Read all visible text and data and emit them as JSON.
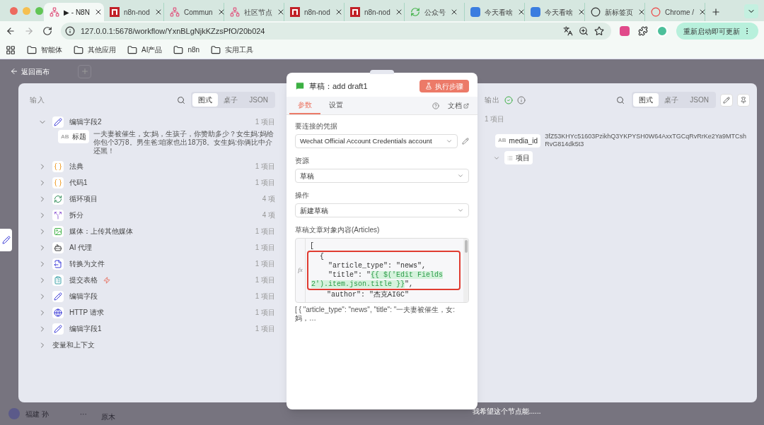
{
  "browser": {
    "tabs": [
      {
        "label": "▶ - N8N",
        "kind": "graph",
        "selected": true
      },
      {
        "label": "n8n-nod",
        "kind": "package",
        "selected": false
      },
      {
        "label": "Commun",
        "kind": "graph",
        "selected": false
      },
      {
        "label": "社区节点",
        "kind": "graph",
        "selected": false
      },
      {
        "label": "n8n-nod",
        "kind": "package",
        "selected": false
      },
      {
        "label": "n8n-nod",
        "kind": "package",
        "selected": false
      },
      {
        "label": "公众号",
        "kind": "recycle",
        "selected": false
      },
      {
        "label": "今天看啥",
        "kind": "square",
        "selected": false
      },
      {
        "label": "今天看啥",
        "kind": "square",
        "selected": false
      },
      {
        "label": "新标签页",
        "kind": "ring",
        "selected": false
      },
      {
        "label": "Chrome /",
        "kind": "redring",
        "selected": false
      }
    ],
    "url": "127.0.0.1:5678/workflow/YxnBLgNjkKZzsPfO/20b024",
    "update_button": "重新启动即可更新",
    "bookmarks": [
      "智能体",
      "其他应用",
      "AI产品",
      "n8n",
      "实用工具"
    ]
  },
  "back_link": "返回画布",
  "input_panel": {
    "title": "输入",
    "view_tabs": [
      {
        "label": "图式",
        "selected": true
      },
      {
        "label": "桌子",
        "selected": false
      },
      {
        "label": "JSON",
        "selected": false
      }
    ],
    "nodes": [
      {
        "kind": "edit",
        "name": "编辑字段2",
        "count": "1 项目",
        "expanded": true,
        "trigger": false,
        "fields": [
          {
            "type_badge": "AB",
            "key": "标题",
            "value": "一夫妻被催生，女:妈，生孩子，你赞助多少？女生妈:妈给你包个3万8。男生爸:咱家也出18万8。女生妈:你俩比中介还黑！"
          }
        ]
      },
      {
        "kind": "code",
        "name": "法典",
        "count": "1 项目",
        "expanded": false,
        "trigger": false
      },
      {
        "kind": "code",
        "name": "代码1",
        "count": "1 项目",
        "expanded": false,
        "trigger": false
      },
      {
        "kind": "loop",
        "name": "循环项目",
        "count": "4 项",
        "expanded": false,
        "trigger": false
      },
      {
        "kind": "split",
        "name": "拆分",
        "count": "4 项",
        "expanded": false,
        "trigger": false
      },
      {
        "kind": "media",
        "name": "媒体：上传其他媒体",
        "count": "1 项目",
        "expanded": false,
        "trigger": false
      },
      {
        "kind": "ai",
        "name": "AI 代理",
        "count": "1 项目",
        "expanded": false,
        "trigger": false
      },
      {
        "kind": "file",
        "name": "转换为文件",
        "count": "1 项目",
        "expanded": false,
        "trigger": false
      },
      {
        "kind": "form",
        "name": "提交表格",
        "count": "1 项目",
        "expanded": false,
        "trigger": true
      },
      {
        "kind": "edit",
        "name": "编辑字段",
        "count": "1 项目",
        "expanded": false,
        "trigger": false
      },
      {
        "kind": "http",
        "name": "HTTP 请求",
        "count": "1 项目",
        "expanded": false,
        "trigger": false
      },
      {
        "kind": "edit",
        "name": "编辑字段1",
        "count": "1 项目",
        "expanded": false,
        "trigger": false
      }
    ],
    "variables": "变量和上下文"
  },
  "node_panel": {
    "title": "草稿：add draft1",
    "run_button": "执行步骤",
    "tabs": [
      {
        "label": "参数",
        "selected": true
      },
      {
        "label": "设置",
        "selected": false
      }
    ],
    "docs_link": "文档",
    "credential": {
      "label": "要连接的凭据",
      "value": "Wechat Official Account Credentials account"
    },
    "selects": [
      {
        "label": "资源",
        "value": "草稿"
      },
      {
        "label": "操作",
        "value": "新建草稿"
      }
    ],
    "articles": {
      "label": "草稿文章对象内容(Articles)",
      "fx": "fx",
      "lines": [
        {
          "text": "[",
          "boxed": false
        },
        {
          "text": "  {",
          "boxed": true
        },
        {
          "text": "    \"article_type\": \"news\",",
          "boxed": true
        },
        {
          "text": "    \"title\": \"",
          "expr": "{{ $('Edit Fields2').item.json.title }}",
          "tail": "\",",
          "boxed": true
        },
        {
          "text": "    \"author\": \"杰克AIGC\"",
          "boxed": false
        }
      ],
      "preview": "[ { \"article_type\": \"news\", \"title\": \"一夫妻被催生，女:妈，…"
    }
  },
  "output_panel": {
    "title": "输出",
    "count": "1 项目",
    "view_tabs": [
      {
        "label": "图式",
        "selected": true
      },
      {
        "label": "桌子",
        "selected": false
      },
      {
        "label": "JSON",
        "selected": false
      }
    ],
    "fields": [
      {
        "type_badge": "AB",
        "key": "media_id",
        "value": "3fZ53KHYc51603PzikhQ3YKPYSH0W64AxxTGCqRvRrKe2Ya9MTCshRvG814dk5t3"
      }
    ],
    "list": {
      "key": "项目",
      "expanded": true
    }
  },
  "footer": {
    "user": "福建 孙",
    "more": "···",
    "canvas_label": "原木",
    "hint": "我希望这个节点能......"
  }
}
